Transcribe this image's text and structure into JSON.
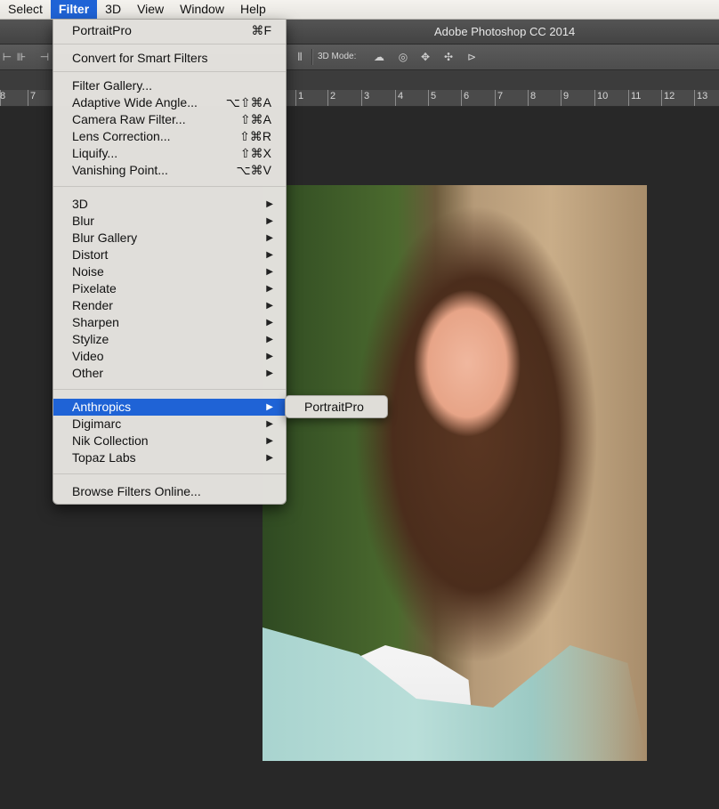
{
  "menubar": {
    "items": [
      "Select",
      "Filter",
      "3D",
      "View",
      "Window",
      "Help"
    ]
  },
  "app": {
    "title": "Adobe Photoshop CC 2014"
  },
  "options_bar": {
    "mode_label": "3D Mode:"
  },
  "ruler": {
    "labels": [
      "8",
      "7",
      "1",
      "2",
      "3",
      "4",
      "5",
      "6",
      "7",
      "8",
      "9",
      "10",
      "11",
      "12",
      "13"
    ]
  },
  "filter_menu": {
    "last_filter": {
      "label": "PortraitPro",
      "shortcut": "⌘F"
    },
    "convert": {
      "label": "Convert for Smart Filters"
    },
    "gallery": [
      {
        "label": "Filter Gallery...",
        "shortcut": ""
      },
      {
        "label": "Adaptive Wide Angle...",
        "shortcut": "⌥⇧⌘A"
      },
      {
        "label": "Camera Raw Filter...",
        "shortcut": "⇧⌘A"
      },
      {
        "label": "Lens Correction...",
        "shortcut": "⇧⌘R"
      },
      {
        "label": "Liquify...",
        "shortcut": "⇧⌘X"
      },
      {
        "label": "Vanishing Point...",
        "shortcut": "⌥⌘V"
      }
    ],
    "categories": [
      "3D",
      "Blur",
      "Blur Gallery",
      "Distort",
      "Noise",
      "Pixelate",
      "Render",
      "Sharpen",
      "Stylize",
      "Video",
      "Other"
    ],
    "plugins": [
      "Anthropics",
      "Digimarc",
      "Nik Collection",
      "Topaz Labs"
    ],
    "highlighted": "Anthropics",
    "browse": {
      "label": "Browse Filters Online..."
    }
  },
  "submenu": {
    "items": [
      "PortraitPro"
    ]
  },
  "colors": {
    "menu_highlight": "#1f63d6",
    "workspace": "#282828"
  }
}
